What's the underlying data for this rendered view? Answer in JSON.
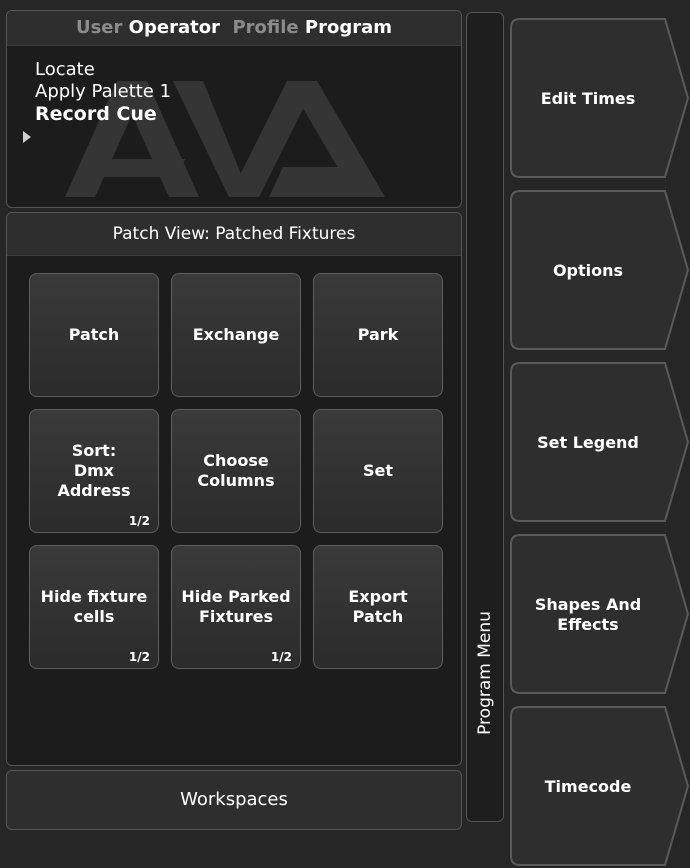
{
  "header": {
    "user_label": "User",
    "user_value": "Operator",
    "profile_label": "Profile",
    "profile_value": "Program"
  },
  "command_history": [
    "Locate",
    "Apply Palette  1",
    "Record Cue"
  ],
  "patch_view": {
    "title": "Patch View: Patched Fixtures",
    "buttons": [
      {
        "label": "Patch",
        "page": ""
      },
      {
        "label": "Exchange",
        "page": ""
      },
      {
        "label": "Park",
        "page": ""
      },
      {
        "label": "Sort:\nDmx\nAddress",
        "page": "1/2"
      },
      {
        "label": "Choose\nColumns",
        "page": ""
      },
      {
        "label": "Set",
        "page": ""
      },
      {
        "label": "Hide fixture\ncells",
        "page": "1/2"
      },
      {
        "label": "Hide Parked\nFixtures",
        "page": "1/2"
      },
      {
        "label": "Export\nPatch",
        "page": ""
      }
    ]
  },
  "workspaces": {
    "label": "Workspaces"
  },
  "side_tab": {
    "label": "Program Menu"
  },
  "softkeys": [
    {
      "label": "Edit Times"
    },
    {
      "label": "Options"
    },
    {
      "label": "Set Legend"
    },
    {
      "label": "Shapes And\nEffects"
    },
    {
      "label": "Timecode"
    }
  ],
  "colors": {
    "background": "#262626",
    "panel": "#1c1c1c",
    "button": "#333333",
    "text": "#ffffff",
    "dim_text": "#8c8c8c"
  }
}
